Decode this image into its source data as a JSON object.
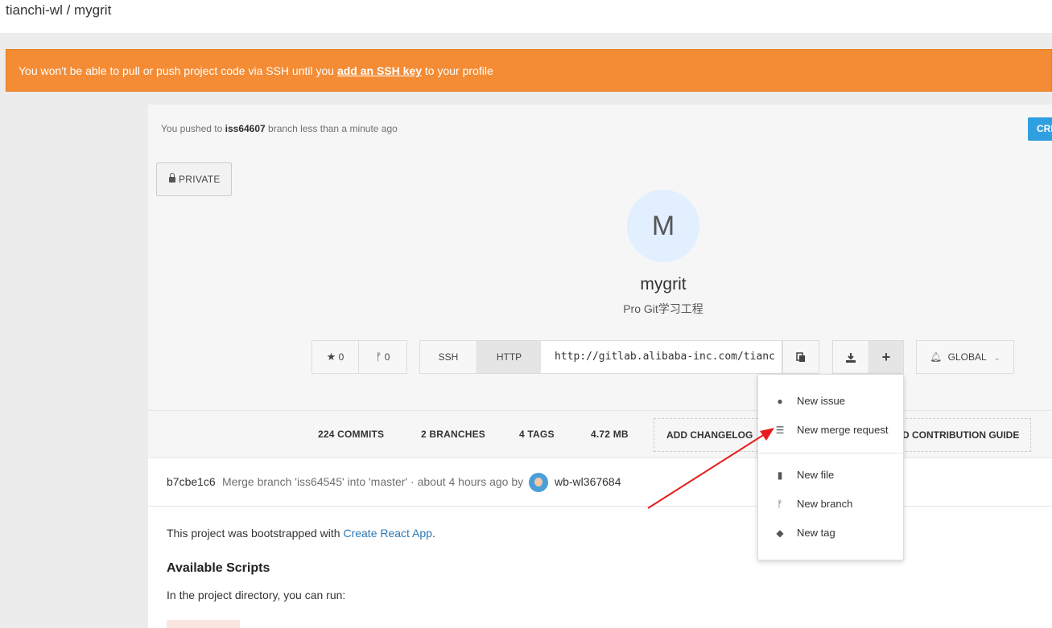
{
  "header": {
    "breadcrumb": "tianchi-wl / mygrit"
  },
  "alert": {
    "text_before": "You won't be able to pull or push project code via SSH until you",
    "link": "add an SSH key",
    "text_after": "to your profile"
  },
  "push": {
    "prefix": "You pushed to",
    "branch": "iss64607",
    "suffix": "branch less than a minute ago"
  },
  "create_button": "CRE",
  "visibility": "PRIVATE",
  "project": {
    "initial": "M",
    "name": "mygrit",
    "description": "Pro Git学习工程"
  },
  "buttons": {
    "star_count": "0",
    "fork_count": "0",
    "ssh": "SSH",
    "http": "HTTP",
    "clone_url": "http://gitlab.alibaba-inc.com/tianc",
    "plus": "+",
    "notification": "GLOBAL"
  },
  "stats": {
    "commits": "224 COMMITS",
    "branches": "2 BRANCHES",
    "tags": "4 TAGS",
    "size": "4.72 MB",
    "changelog": "ADD CHANGELOG",
    "contribution": "D CONTRIBUTION GUIDE"
  },
  "commit": {
    "sha": "b7cbe1c6",
    "message": "Merge branch 'iss64545' into 'master' · about 4 hours ago by",
    "author": "wb-wl367684"
  },
  "readme": {
    "intro_before": "This project was bootstrapped with",
    "intro_link": "Create React App",
    "intro_after": ".",
    "heading": "Available Scripts",
    "paragraph": "In the project directory, you can run:"
  },
  "dropdown": {
    "items": [
      {
        "label": "New issue",
        "icon": "exclamation-circle-icon"
      },
      {
        "label": "New merge request",
        "icon": "merge-request-icon"
      },
      {
        "label": "New file",
        "icon": "file-icon"
      },
      {
        "label": "New branch",
        "icon": "branch-icon"
      },
      {
        "label": "New tag",
        "icon": "tags-icon"
      }
    ]
  },
  "colors": {
    "alert": "#f48c35",
    "link": "#2e78b4",
    "create": "#2f9fe0",
    "arrow": "#e81c1c"
  }
}
